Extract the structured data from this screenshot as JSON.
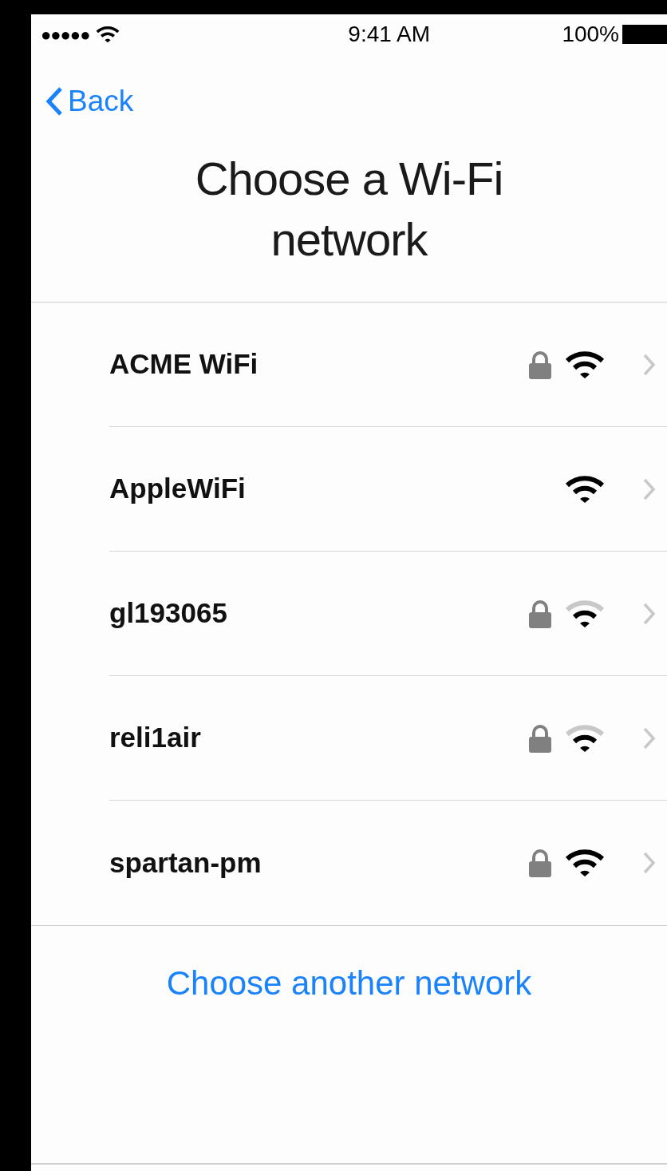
{
  "status_bar": {
    "signal_dots": "●●●●●",
    "time": "9:41 AM",
    "battery": "100%"
  },
  "nav": {
    "back": "Back"
  },
  "title": "Choose a Wi-Fi network",
  "networks": [
    {
      "name": "ACME WiFi",
      "locked": true,
      "full_signal": true
    },
    {
      "name": "AppleWiFi",
      "locked": false,
      "full_signal": true
    },
    {
      "name": "gl193065",
      "locked": true,
      "full_signal": false
    },
    {
      "name": "reli1air",
      "locked": true,
      "full_signal": false
    },
    {
      "name": "spartan-pm",
      "locked": true,
      "full_signal": true
    }
  ],
  "other_network": "Choose another network"
}
